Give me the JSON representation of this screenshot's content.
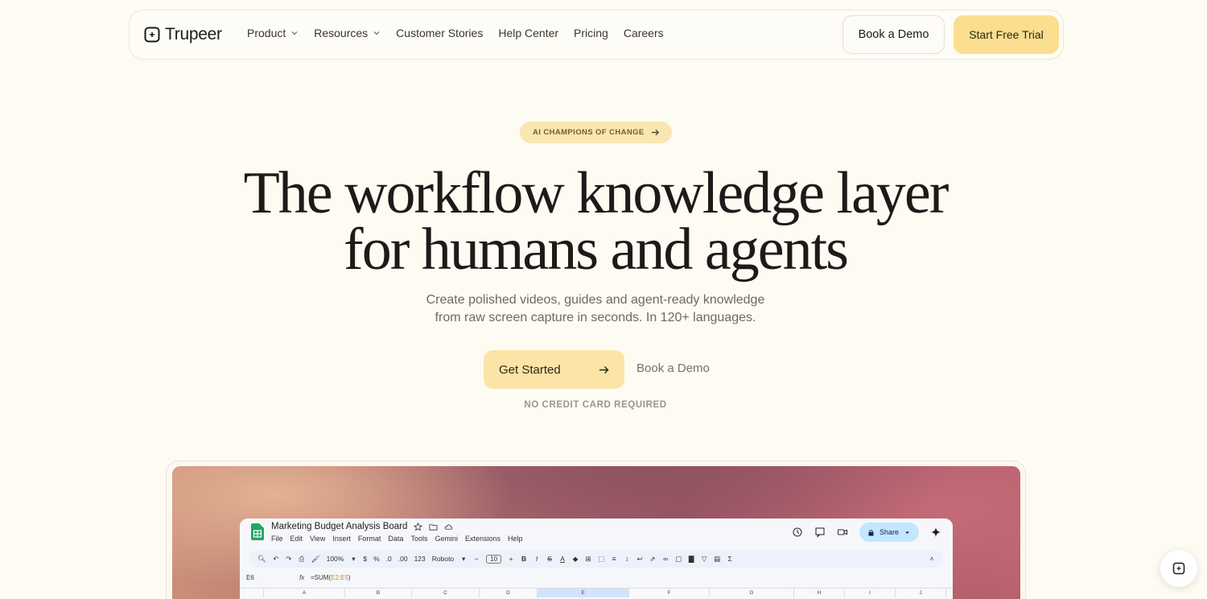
{
  "nav": {
    "logo_text": "Trupeer",
    "links": [
      {
        "label": "Product",
        "has_dropdown": true
      },
      {
        "label": "Resources",
        "has_dropdown": true
      },
      {
        "label": "Customer Stories",
        "has_dropdown": false
      },
      {
        "label": "Help Center",
        "has_dropdown": false
      },
      {
        "label": "Pricing",
        "has_dropdown": false
      },
      {
        "label": "Careers",
        "has_dropdown": false
      }
    ],
    "book_demo_label": "Book a Demo",
    "start_trial_label": "Start Free Trial"
  },
  "hero": {
    "pill_label": "AI CHAMPIONS OF CHANGE",
    "headline_line1": "The workflow knowledge layer",
    "headline_line2": "for humans and agents",
    "subtitle_line1": "Create polished videos, guides and agent-ready knowledge",
    "subtitle_line2": "from raw screen capture in seconds. In 120+ languages.",
    "get_started_label": "Get Started",
    "book_demo_label": "Book a Demo",
    "no_credit_card": "NO CREDIT CARD REQUIRED"
  },
  "sheet": {
    "title": "Marketing Budget Analysis Board",
    "menu": [
      "File",
      "Edit",
      "View",
      "Insert",
      "Format",
      "Data",
      "Tools",
      "Gemini",
      "Extensions",
      "Help"
    ],
    "share_label": "Share",
    "toolbar": {
      "zoom": "100%",
      "currency": "$",
      "percent": "%",
      "decimal_dec": ".0",
      "decimal_inc": ".00",
      "number_format": "123",
      "font": "Roboto",
      "font_size": "10"
    },
    "cell_ref": "E6",
    "fx": "fx",
    "formula_prefix": "=SUM(",
    "formula_range": "E2:E5",
    "formula_suffix": ")",
    "columns": [
      "A",
      "B",
      "C",
      "D",
      "E",
      "F",
      "G",
      "H",
      "I",
      "J"
    ]
  },
  "colors": {
    "background": "#fefbf3",
    "accent_yellow": "#fbde8f",
    "pill_bg": "#f8e6b3",
    "share_blue": "#c2e7ff"
  }
}
